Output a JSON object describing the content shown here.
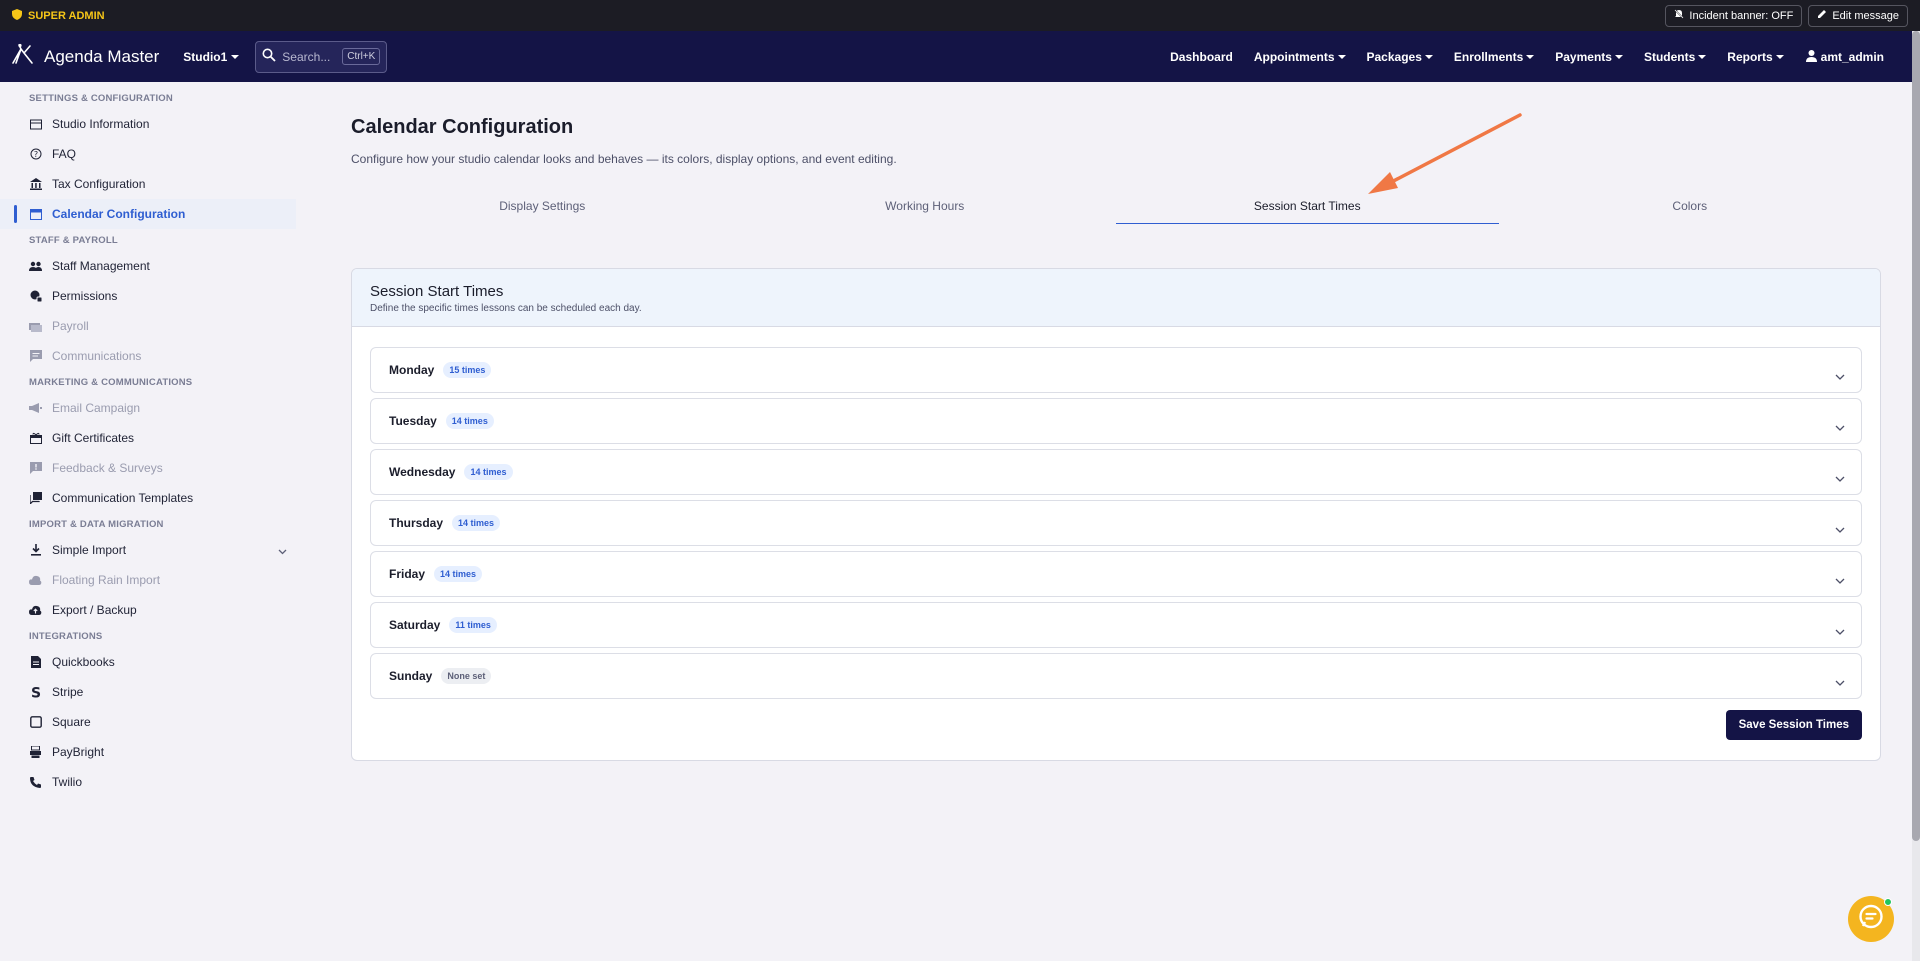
{
  "admin_bar": {
    "label": "SUPER ADMIN",
    "incident_banner": "Incident banner: OFF",
    "edit_message": "Edit message"
  },
  "navbar": {
    "brand": "Agenda Master",
    "studio": "Studio1",
    "search_placeholder": "Search...",
    "shortcut": "Ctrl+K",
    "links": [
      {
        "label": "Dashboard"
      },
      {
        "label": "Appointments"
      },
      {
        "label": "Packages"
      },
      {
        "label": "Enrollments"
      },
      {
        "label": "Payments"
      },
      {
        "label": "Students"
      },
      {
        "label": "Reports"
      }
    ],
    "user": "amt_admin"
  },
  "sidebar": {
    "sections": [
      {
        "title": "SETTINGS & CONFIGURATION",
        "items": [
          {
            "label": "Studio Information",
            "icon": "studio-icon"
          },
          {
            "label": "FAQ",
            "icon": "help-icon"
          },
          {
            "label": "Tax Configuration",
            "icon": "bank-icon"
          },
          {
            "label": "Calendar Configuration",
            "icon": "calendar-icon",
            "active": true
          }
        ]
      },
      {
        "title": "STAFF & PAYROLL",
        "items": [
          {
            "label": "Staff Management",
            "icon": "people-icon"
          },
          {
            "label": "Permissions",
            "icon": "permissions-icon"
          },
          {
            "label": "Payroll",
            "icon": "payroll-icon",
            "disabled": true
          },
          {
            "label": "Communications",
            "icon": "chat-icon",
            "disabled": true
          }
        ]
      },
      {
        "title": "MARKETING & COMMUNICATIONS",
        "items": [
          {
            "label": "Email Campaign",
            "icon": "megaphone-icon",
            "disabled": true
          },
          {
            "label": "Gift Certificates",
            "icon": "gift-icon"
          },
          {
            "label": "Feedback & Surveys",
            "icon": "feedback-icon",
            "disabled": true
          },
          {
            "label": "Communication Templates",
            "icon": "templates-icon"
          }
        ]
      },
      {
        "title": "IMPORT & DATA MIGRATION",
        "items": [
          {
            "label": "Simple Import",
            "icon": "download-icon",
            "expandable": true
          },
          {
            "label": "Floating Rain Import",
            "icon": "cloud-icon",
            "disabled": true
          },
          {
            "label": "Export / Backup",
            "icon": "cloud-upload-icon"
          }
        ]
      },
      {
        "title": "INTEGRATIONS",
        "items": [
          {
            "label": "Quickbooks",
            "icon": "document-icon"
          },
          {
            "label": "Stripe",
            "icon": "stripe-icon"
          },
          {
            "label": "Square",
            "icon": "square-icon"
          },
          {
            "label": "PayBright",
            "icon": "paybright-icon"
          },
          {
            "label": "Twilio",
            "icon": "phone-icon"
          }
        ]
      }
    ]
  },
  "page": {
    "title": "Calendar Configuration",
    "subtitle": "Configure how your studio calendar looks and behaves — its colors, display options, and event editing.",
    "tabs": [
      {
        "label": "Display Settings"
      },
      {
        "label": "Working Hours"
      },
      {
        "label": "Session Start Times",
        "active": true
      },
      {
        "label": "Colors"
      }
    ]
  },
  "card": {
    "title": "Session Start Times",
    "description": "Define the specific times lessons can be scheduled each day.",
    "days": [
      {
        "name": "Monday",
        "badge": "15 times"
      },
      {
        "name": "Tuesday",
        "badge": "14 times"
      },
      {
        "name": "Wednesday",
        "badge": "14 times"
      },
      {
        "name": "Thursday",
        "badge": "14 times"
      },
      {
        "name": "Friday",
        "badge": "14 times"
      },
      {
        "name": "Saturday",
        "badge": "11 times"
      },
      {
        "name": "Sunday",
        "badge": "None set",
        "none": true
      }
    ],
    "save_label": "Save Session Times"
  },
  "colors": {
    "navbar": "#141446",
    "accent": "#2f5ed1",
    "annotation_arrow": "#f07845",
    "chat_button": "#f4b51f"
  }
}
